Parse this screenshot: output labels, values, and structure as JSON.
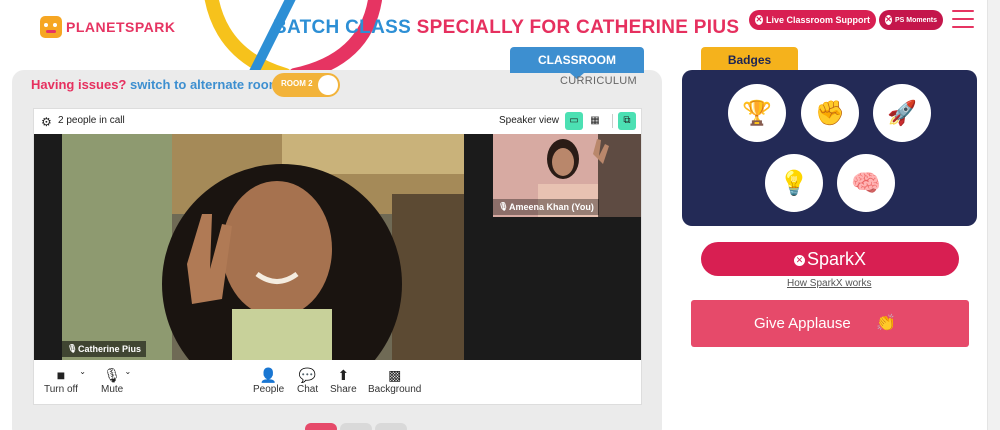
{
  "header": {
    "logo_text": "PLANETSPARK",
    "title_part1": "BATCH CLASS",
    "title_part2": "SPECIALLY FOR CATHERINE PIUS",
    "live_support": "Live Classroom Support",
    "ps_moments": "PS Moments"
  },
  "classroom": {
    "tab_label": "CLASSROOM",
    "curriculum_label": "CURRICULUM",
    "issue_question": "Having issues?",
    "issue_switch": "switch to alternate room",
    "room_toggle_label": "ROOM 2"
  },
  "call": {
    "people_count": "2 people in call",
    "speaker_view": "Speaker view",
    "main_participant": "Catherine Pius",
    "side_participant": "Ameena Khan (You)",
    "controls": {
      "camera": "Turn off",
      "mic": "Mute",
      "people": "People",
      "chat": "Chat",
      "share": "Share",
      "background": "Background"
    }
  },
  "badges": {
    "tab_label": "Badges",
    "items": [
      "trophy-badge",
      "fist-badge",
      "rocket-badge",
      "lightbulb-badge",
      "brain-badge"
    ]
  },
  "sparkx": {
    "button_label": "SparkX",
    "how_link": "How SparkX works"
  },
  "applause": {
    "button_label": "Give Applause"
  },
  "colors": {
    "brand_pink": "#d81f52",
    "brand_blue": "#2d8fd5",
    "badge_navy": "#232a56",
    "badge_tab": "#f5b21c",
    "toggle_yellow": "#f2b33a",
    "active_view": "#4ce0b3"
  }
}
